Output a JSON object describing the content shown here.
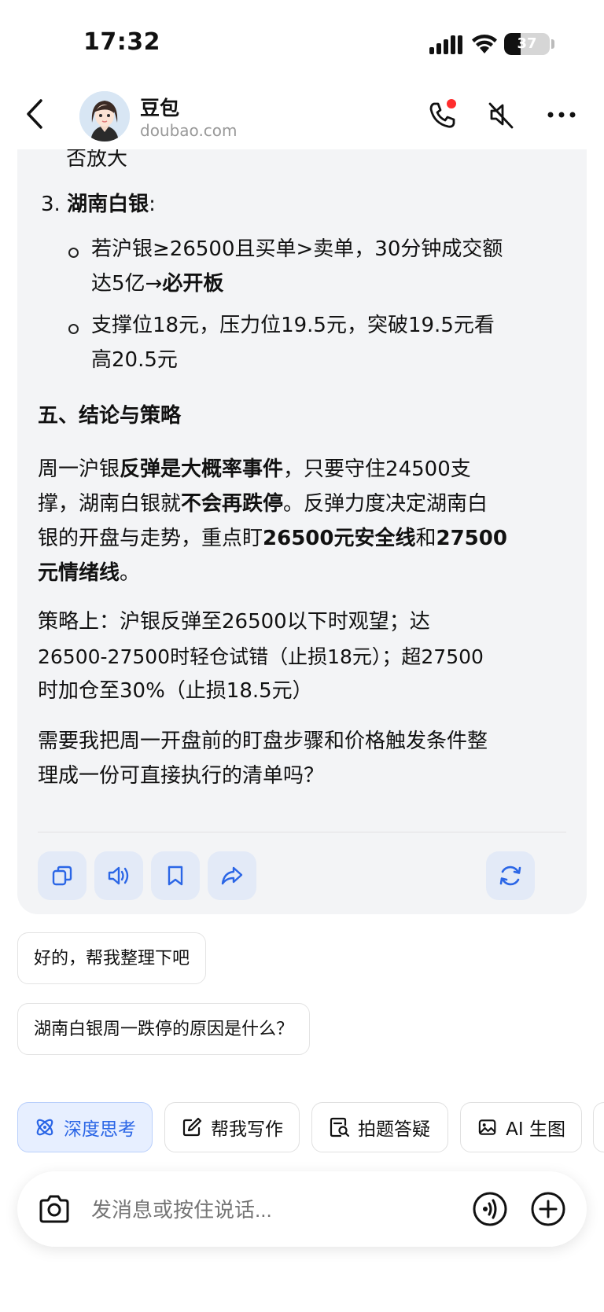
{
  "status_bar": {
    "time": "17:32",
    "battery": "37",
    "battery_level": 0.37
  },
  "header": {
    "name": "豆包",
    "domain": "doubao.com"
  },
  "message": {
    "line0": "否放大",
    "item3_num": "3.",
    "item3_title": "湖南白银",
    "item3_colon": ":",
    "b1_l1": "若沪银≥26500且买单>卖单，30分钟成交额",
    "b1_l2_a": "达5亿→",
    "b1_l2_b": "必开板",
    "b2_l1": "支撑位18元，压力位19.5元，突破19.5元看",
    "b2_l2": "高20.5元",
    "section5": "五、结论与策略",
    "p1_l1_a": "周一沪银",
    "p1_l1_b": "反弹是大概率事件",
    "p1_l1_c": "，只要守住24500支",
    "p1_l2_a": "撑，湖南白银就",
    "p1_l2_b": "不会再跌停",
    "p1_l2_c": "。反弹力度决定湖南白",
    "p1_l3_a": "银的开盘与走势，重点盯",
    "p1_l3_b": "26500元安全线",
    "p1_l3_c": "和",
    "p1_l3_d": "27500",
    "p1_l4_a": "元情绪线",
    "p1_l4_b": "。",
    "p2_l1": "策略上：沪银反弹至26500以下时观望；达",
    "p2_l2": "26500-27500时轻仓试错（止损18元）；超27500",
    "p2_l3": "时加仓至30%（止损18.5元）",
    "p3_l1": "需要我把周一开盘前的盯盘步骤和价格触发条件整",
    "p3_l2": "理成一份可直接执行的清单吗？"
  },
  "suggestions": [
    "好的，帮我整理下吧",
    "湖南白银周一跌停的原因是什么？"
  ],
  "tools": [
    {
      "label": "深度思考",
      "icon": "atom-icon"
    },
    {
      "label": "帮我写作",
      "icon": "edit-icon"
    },
    {
      "label": "拍题答疑",
      "icon": "scan-question-icon"
    },
    {
      "label": "AI 生图",
      "icon": "image-icon"
    }
  ],
  "input": {
    "placeholder": "发消息或按住说话..."
  },
  "colors": {
    "accent": "#2b66e6",
    "card_bg": "#f3f4f6",
    "action_bg": "#e3eaf7",
    "badge_red": "#ff2d2d"
  }
}
